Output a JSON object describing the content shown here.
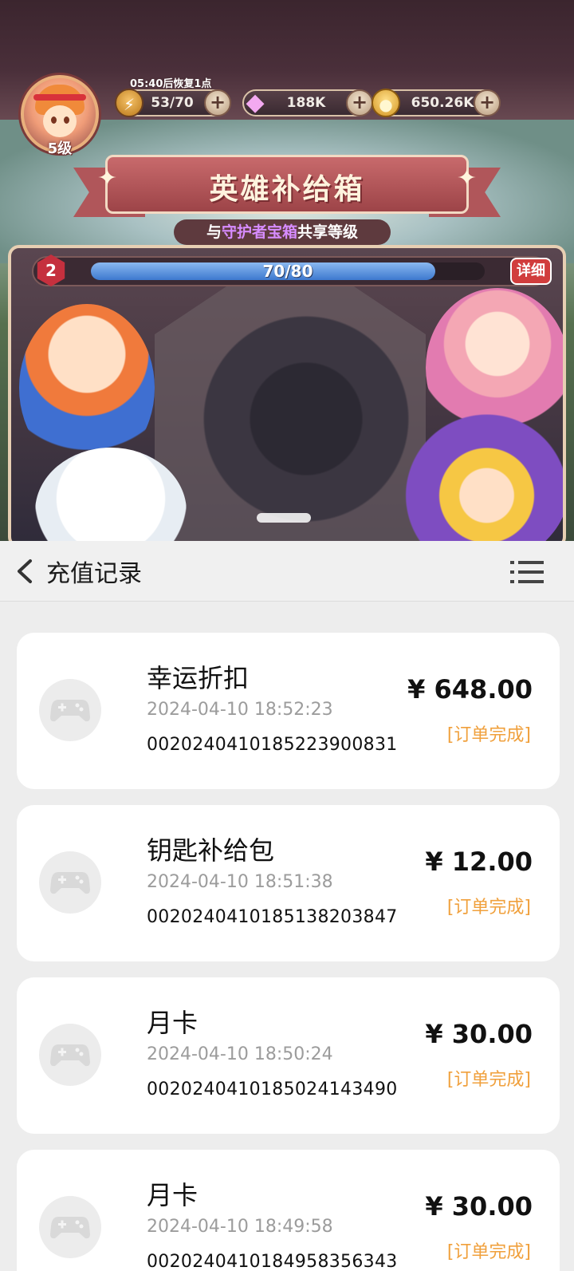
{
  "game": {
    "recover_text": "05:40后恢复1点",
    "level": "5级",
    "energy": "53/70",
    "gems": "188K",
    "coins": "650.26K",
    "banner_title": "英雄补给箱",
    "subtitle_parts": [
      "与",
      "守护者宝箱",
      "共享等级"
    ],
    "box_level": "2",
    "progress_text": "70/80",
    "progress_fraction": 0.875,
    "detail_button": "详细"
  },
  "nav": {
    "title": "充值记录"
  },
  "records": [
    {
      "name": "幸运折扣",
      "time": "2024-04-10 18:52:23",
      "order_id": "0020240410185223900831",
      "price": "¥ 648.00",
      "status": "[订单完成]"
    },
    {
      "name": "钥匙补给包",
      "time": "2024-04-10 18:51:38",
      "order_id": "0020240410185138203847",
      "price": "¥ 12.00",
      "status": "[订单完成]"
    },
    {
      "name": "月卡",
      "time": "2024-04-10 18:50:24",
      "order_id": "0020240410185024143490",
      "price": "¥ 30.00",
      "status": "[订单完成]"
    },
    {
      "name": "月卡",
      "time": "2024-04-10 18:49:58",
      "order_id": "0020240410184958356343",
      "price": "¥ 30.00",
      "status": "[订单完成]"
    }
  ],
  "colors": {
    "status": "#f0a03c",
    "progress_fill": "#3d79cf"
  }
}
